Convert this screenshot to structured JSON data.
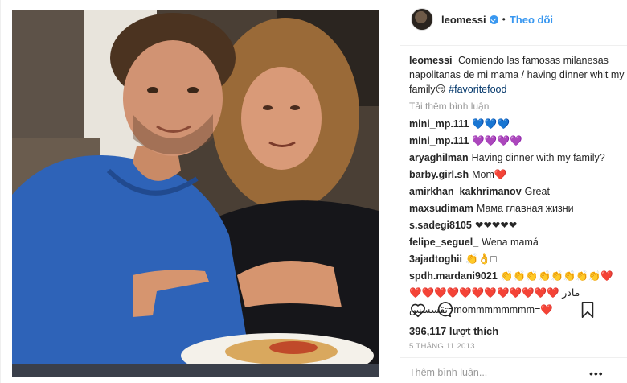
{
  "header": {
    "username": "leomessi",
    "separator": "•",
    "follow_label": "Theo dõi"
  },
  "caption": {
    "username": "leomessi",
    "text": "Comiendo las famosas milanesas napolitanas de mi mama / having dinner whit my family😏",
    "hashtag": "#favoritefood"
  },
  "load_more_label": "Tải thêm bình luận",
  "comments": [
    {
      "user": "mini_mp.111",
      "text": "💙💙💙"
    },
    {
      "user": "mini_mp.111",
      "text": "💜💜💜💜"
    },
    {
      "user": "aryaghilman",
      "text": "Having dinner with my family?"
    },
    {
      "user": "barby.girl.sh",
      "text": "Mom❤️"
    },
    {
      "user": "amirkhan_kakhrimanov",
      "text": "Great"
    },
    {
      "user": "maxsudimam",
      "text": "Мама главная жизни"
    },
    {
      "user": "s.sadegi8105",
      "text": "❤❤❤❤❤"
    },
    {
      "user": "felipe_seguel_",
      "text": "Wena mamá"
    },
    {
      "user": "3ajadtoghii",
      "text": "👏👌□"
    },
    {
      "user": "spdh.mardani9021",
      "text": "👏👏👏👏👏👏👏👏❤️"
    }
  ],
  "comment_wrap": {
    "line2": "❤️❤️❤️❤️❤️❤️❤️❤️❤️❤️❤️❤️ مادر",
    "line3": "تقسسس=mommmmmmmm=❤️"
  },
  "likes_label": "396,117 lượt thích",
  "date_label": "5 THÁNG 11 2013",
  "add_comment_placeholder": "Thêm bình luận...",
  "more_options": "•••",
  "icons": [
    "heart-icon",
    "comment-icon",
    "bookmark-icon",
    "verified-badge-icon"
  ],
  "colors": {
    "link": "#3897f0",
    "hashtag": "#003569",
    "muted": "#999999"
  }
}
